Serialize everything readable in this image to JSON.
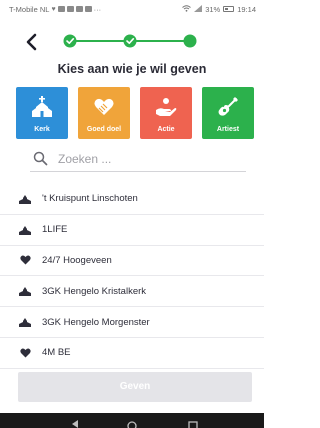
{
  "status_bar": {
    "carrier": "T-Mobile NL",
    "battery": "31%",
    "time": "19:14"
  },
  "heading": "Kies aan wie je wil geven",
  "stepper": {
    "steps": 3,
    "completed": 2,
    "current": 3
  },
  "categories": [
    {
      "label": "Kerk",
      "icon": "church-icon",
      "color": "#2d8fd8"
    },
    {
      "label": "Goed doel",
      "icon": "heart-hands-icon",
      "color": "#f0a43a"
    },
    {
      "label": "Actie",
      "icon": "hand-icon",
      "color": "#ef6350"
    },
    {
      "label": "Artiest",
      "icon": "guitar-icon",
      "color": "#2cb14c"
    }
  ],
  "search": {
    "placeholder": "Zoeken ...",
    "value": ""
  },
  "recipients": [
    {
      "name": "'t Kruispunt Linschoten",
      "icon": "church-icon"
    },
    {
      "name": "1LIFE",
      "icon": "church-icon"
    },
    {
      "name": "24/7 Hoogeveen",
      "icon": "heart-icon"
    },
    {
      "name": "3GK Hengelo Kristalkerk",
      "icon": "church-icon"
    },
    {
      "name": "3GK Hengelo Morgenster",
      "icon": "church-icon"
    },
    {
      "name": "4M BE",
      "icon": "heart-icon"
    }
  ],
  "give_button": "Geven",
  "colors": {
    "accent": "#2cb14c",
    "text": "#2e2e3a",
    "button_disabled": "#e4e4e8"
  }
}
